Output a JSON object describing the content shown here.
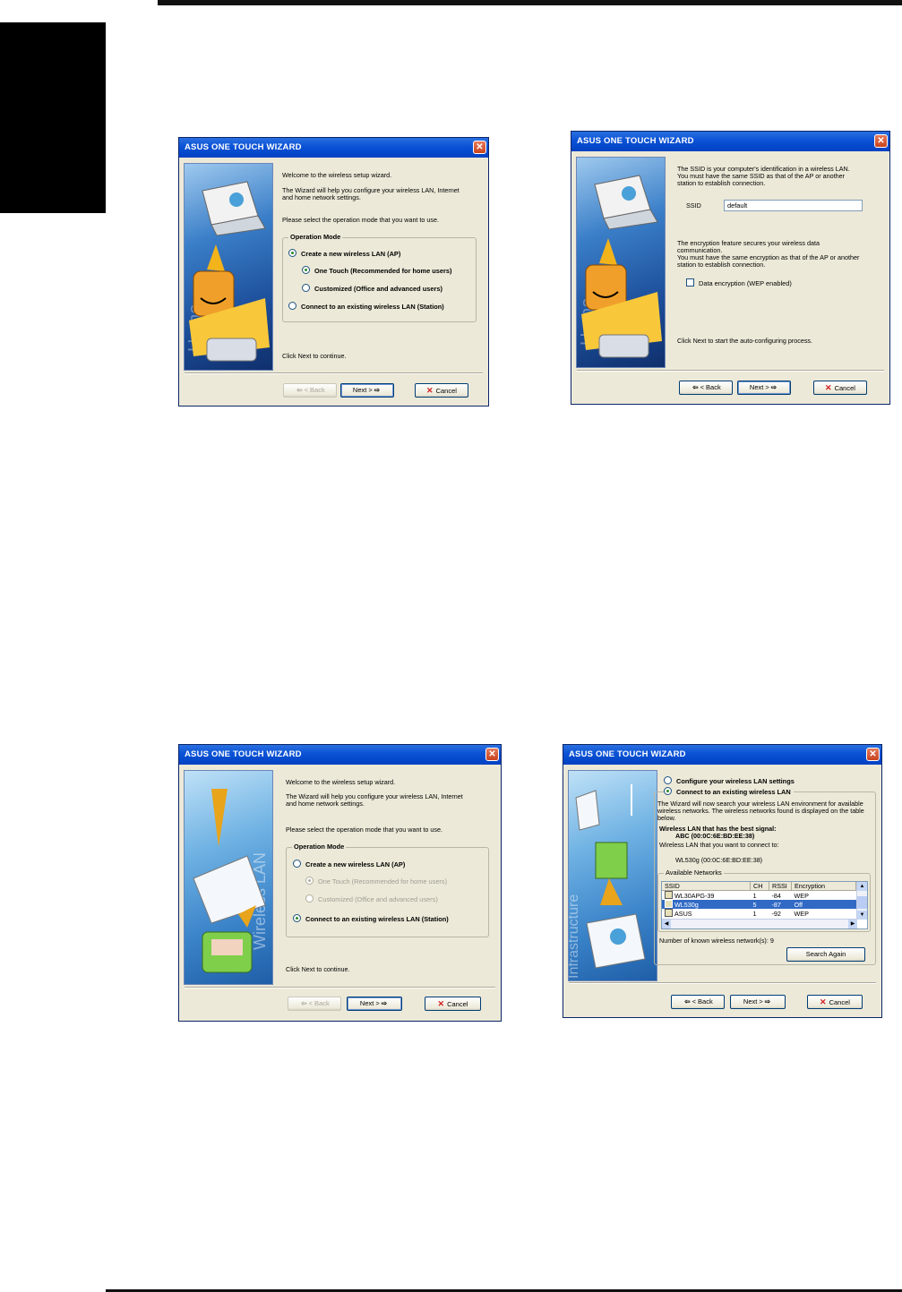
{
  "window_title": "ASUS ONE TOUCH WIZARD",
  "close_glyph": "✕",
  "art_watermarks": {
    "home": "Home",
    "wireless": "Wireless LAN",
    "infra": "Infrastructure"
  },
  "dialog1": {
    "welcome": "Welcome to the wireless setup wizard.",
    "help_l1": "The Wizard will help you configure your wireless LAN, Internet",
    "help_l2": "and home network settings.",
    "select": "Please select the operation mode that you want to use.",
    "group_title": "Operation Mode",
    "opt_ap": "Create a new wireless LAN (AP)",
    "opt_onetouch": "One Touch (Recommended for home users)",
    "opt_custom": "Customized (Office and advanced users)",
    "opt_station": "Connect to an existing wireless LAN (Station)",
    "footer": "Click Next to continue.",
    "back": "< Back",
    "next": "Next >",
    "cancel": "Cancel"
  },
  "dialog2": {
    "ssid_l1": "The SSID is your computer's identification in a wireless LAN.",
    "ssid_l2": "You must have the same SSID as that of the AP or another",
    "ssid_l3": "station to establish connection.",
    "ssid_label": "SSID",
    "ssid_value": "default",
    "enc_l1": "The encryption feature secures your wireless data",
    "enc_l2": "communication.",
    "enc_l3": "You must have the same encryption as that of the AP or another",
    "enc_l4": "station to establish connection.",
    "wep_label": "Data encryption (WEP enabled)",
    "footer": "Click Next to start the auto-configuring process.",
    "back": "< Back",
    "next": "Next >",
    "cancel": "Cancel"
  },
  "dialog3": {
    "welcome": "Welcome to the wireless setup wizard.",
    "help_l1": "The Wizard will help you configure your wireless LAN, Internet",
    "help_l2": "and home network settings.",
    "select": "Please select the operation mode that you want to use.",
    "group_title": "Operation Mode",
    "opt_ap": "Create a new wireless LAN (AP)",
    "opt_onetouch": "One Touch (Recommended for home users)",
    "opt_custom": "Customized (Office and advanced users)",
    "opt_station": "Connect to an existing wireless LAN (Station)",
    "footer": "Click Next to continue.",
    "back": "< Back",
    "next": "Next >",
    "cancel": "Cancel"
  },
  "dialog4": {
    "opt_configure": "Configure your wireless LAN settings",
    "opt_connect": "Connect to an existing wireless LAN",
    "desc_l1": "The Wizard will now search your wireless LAN environment for available",
    "desc_l2": "wireless networks. The wireless networks found is displayed on the table",
    "desc_l3": "below.",
    "best_label": "Wireless LAN that has the best signal:",
    "best_value": "ABC (00:0C:6E:BD:EE:38)",
    "connect_label": "Wireless LAN that you want to connect to:",
    "connect_value": "WL530g (00:0C:6E:BD:EE:38)",
    "avail_title": "Available Networks",
    "columns": [
      "SSID",
      "CH",
      "RSSI",
      "Encryption"
    ],
    "rows": [
      [
        "WL30APG-39",
        "1",
        "-84",
        "WEP"
      ],
      [
        "WL530g",
        "5",
        "-87",
        "Off"
      ],
      [
        "ASUS",
        "1",
        "-92",
        "WEP"
      ]
    ],
    "known": "Number of known wireless network(s): 9",
    "search_again": "Search Again",
    "back": "< Back",
    "next": "Next >",
    "cancel": "Cancel"
  }
}
